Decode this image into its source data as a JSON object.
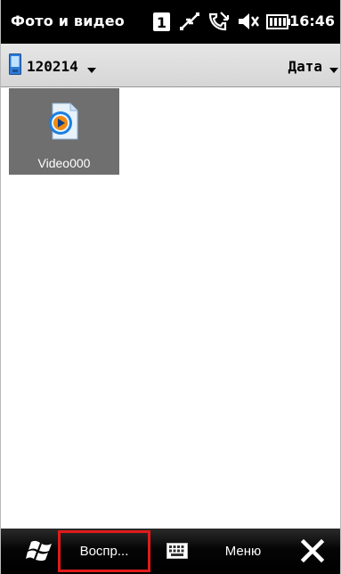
{
  "titlebar": {
    "title": "Фото и видео",
    "time": "16:46",
    "status_icons": [
      "sim-1-icon",
      "data-transfer-icon",
      "missed-call-icon",
      "speaker-mute-icon",
      "battery-icon"
    ],
    "sim_number": "1"
  },
  "toolbar": {
    "folder_icon": "device-icon",
    "folder_label": "120214",
    "sort_label": "Дата"
  },
  "content": {
    "items": [
      {
        "name": "Video000",
        "icon": "media-player-icon",
        "selected": true
      }
    ]
  },
  "menubar": {
    "start_icon": "windows-flag-icon",
    "left_softkey": "Воспр...",
    "keyboard_icon": "keyboard-icon",
    "right_softkey": "Меню",
    "close_icon": "close-icon"
  },
  "colors": {
    "titlebar_bg": "#000000",
    "toolbar_bg": "#dcdcdc",
    "tile_selected_bg": "#6f6f6f",
    "softkey_highlight": "#e01a1a"
  }
}
